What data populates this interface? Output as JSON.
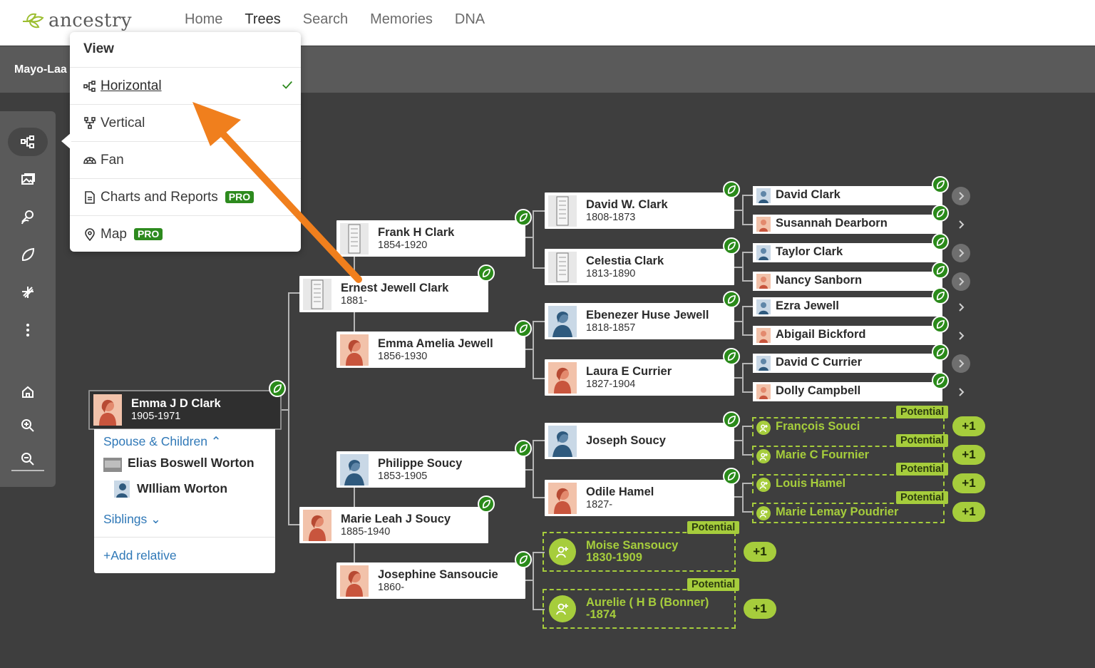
{
  "brand": {
    "name": "ancestry",
    "color": "#9cbe30"
  },
  "nav": [
    "Home",
    "Trees",
    "Search",
    "Memories",
    "DNA"
  ],
  "nav_active": "Trees",
  "tree_name": "Mayo-Laa",
  "view_menu": {
    "title": "View",
    "items": [
      {
        "label": "Horizontal",
        "icon": "horizontal-tree-icon",
        "selected": true
      },
      {
        "label": "Vertical",
        "icon": "vertical-tree-icon"
      },
      {
        "label": "Fan",
        "icon": "fan-chart-icon"
      },
      {
        "label": "Charts and Reports",
        "icon": "document-icon",
        "badge": "PRO"
      },
      {
        "label": "Map",
        "icon": "map-pin-icon",
        "badge": "PRO"
      }
    ]
  },
  "root": {
    "name": "Emma J D Clark",
    "dates": "1905-1971"
  },
  "panel": {
    "spouse_link": "Spouse & Children",
    "spouse": "Elias Boswell Worton",
    "child": "WIlliam Worton",
    "siblings_link": "Siblings",
    "add_relative": "Add relative"
  },
  "people": {
    "ernest": {
      "name": "Ernest Jewell Clark",
      "dates": "1881-"
    },
    "marie_leah": {
      "name": "Marie Leah J Soucy",
      "dates": "1885-1940"
    },
    "frank": {
      "name": "Frank H Clark",
      "dates": "1854-1920"
    },
    "emma_amelia": {
      "name": "Emma Amelia Jewell",
      "dates": "1856-1930"
    },
    "philippe": {
      "name": "Philippe Soucy",
      "dates": "1853-1905"
    },
    "josephine": {
      "name": "Josephine Sansoucie",
      "dates": "1860-"
    },
    "david_w": {
      "name": "David W. Clark",
      "dates": "1808-1873"
    },
    "celestia": {
      "name": "Celestia Clark",
      "dates": "1813-1890"
    },
    "ebenezer": {
      "name": "Ebenezer Huse Jewell",
      "dates": "1818-1857"
    },
    "laura": {
      "name": "Laura E Currier",
      "dates": "1827-1904"
    },
    "joseph": {
      "name": "Joseph Soucy",
      "dates": ""
    },
    "odile": {
      "name": "Odile Hamel",
      "dates": "1827-"
    }
  },
  "gen4": [
    {
      "name": "David Clark",
      "gender": "m"
    },
    {
      "name": "Susannah Dearborn",
      "gender": "f"
    },
    {
      "name": "Taylor Clark",
      "gender": "m"
    },
    {
      "name": "Nancy Sanborn",
      "gender": "f"
    },
    {
      "name": "Ezra Jewell",
      "gender": "m"
    },
    {
      "name": "Abigail Bickford",
      "gender": "f"
    },
    {
      "name": "David C Currier",
      "gender": "m"
    },
    {
      "name": "Dolly Campbell",
      "gender": "f"
    }
  ],
  "potential": {
    "tag": "Potential",
    "count": "+1",
    "gen4": [
      "François Souci",
      "Marie C Fournier",
      "Louis Hamel",
      "Marie Lemay Poudrier"
    ],
    "moise": {
      "name": "Moise Sansoucy",
      "dates": "1830-1909"
    },
    "aurelie": {
      "name": "Aurelie ( H B (Bonner)",
      "dates": "-1874"
    }
  }
}
